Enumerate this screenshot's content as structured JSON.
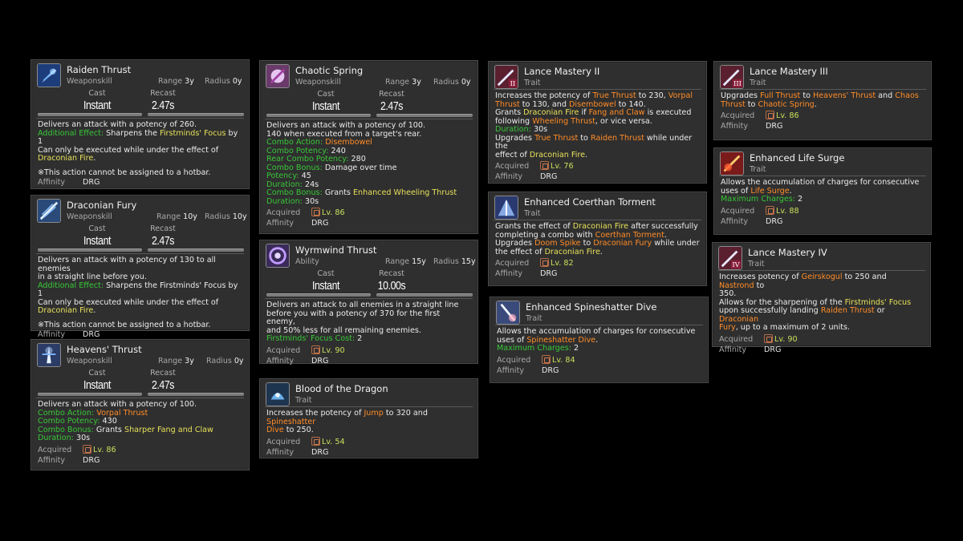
{
  "labels": {
    "cast": "Cast",
    "recast": "Recast",
    "range": "Range",
    "radius": "Radius",
    "acquired": "Acquired",
    "affinity": "Affinity"
  },
  "cards": {
    "raiden": {
      "title": "Raiden Thrust",
      "kind": "Weaponskill",
      "range": "3y",
      "radius": "0y",
      "cast": "Instant",
      "recast": "2.47s",
      "d1": "Delivers an attack with a potency of 260.",
      "d2a": "Additional Effect:",
      "d2b": " Sharpens the ",
      "d2c": "Firstminds' Focus",
      "d2d": " by 1",
      "d3": "Can only be executed while under the effect of",
      "d4": "Draconian Fire",
      "d4b": ".",
      "note": "※This action cannot be assigned to a hotbar.",
      "affinity": "DRG"
    },
    "fury": {
      "title": "Draconian Fury",
      "kind": "Weaponskill",
      "range": "10y",
      "radius": "10y",
      "cast": "Instant",
      "recast": "2.47s",
      "d1": "Delivers an attack with a potency of 130 to all enemies",
      "d1b": "in a straight line before you.",
      "d2a": "Additional Effect:",
      "d2b": " Sharpens the Firstminds' Focus by 1",
      "d3": "Can only be executed while under the effect of",
      "d4": "Draconian Fire",
      "d4b": ".",
      "note": "※This action cannot be assigned to a hotbar.",
      "affinity": "DRG"
    },
    "heavens": {
      "title": "Heavens' Thrust",
      "kind": "Weaponskill",
      "range": "3y",
      "radius": "0y",
      "cast": "Instant",
      "recast": "2.47s",
      "d1": "Delivers an attack with a potency of 100.",
      "d2a": "Combo Action:",
      "d2b": "Vorpal Thrust",
      "d3a": "Combo Potency:",
      "d3b": "430",
      "d4a": "Combo Bonus:",
      "d4b": "Grants",
      "d4c": "Sharper Fang and Claw",
      "d5a": "Duration:",
      "d5b": "30s",
      "level": "Lv. 86",
      "affinity": "DRG"
    },
    "chaotic": {
      "title": "Chaotic Spring",
      "kind": "Weaponskill",
      "range": "3y",
      "radius": "0y",
      "cast": "Instant",
      "recast": "2.47s",
      "d1": "Delivers an attack with a potency of 100.",
      "d1b": "140 when executed from a target's rear.",
      "d2a": "Combo Action:",
      "d2b": "Disembowel",
      "d3a": "Combo Potency:",
      "d3b": "240",
      "d4a": "Rear Combo Potency:",
      "d4b": "280",
      "d5a": "Combo Bonus:",
      "d5b": "Damage over time",
      "d6a": "Potency:",
      "d6b": "45",
      "d7a": "Duration:",
      "d7b": "24s",
      "d8a": "Combo Bonus:",
      "d8b": "Grants",
      "d8c": "Enhanced Wheeling Thrust",
      "d9a": "Duration:",
      "d9b": "30s",
      "level": "Lv. 86",
      "affinity": "DRG"
    },
    "wyrmwind": {
      "title": "Wyrmwind Thrust",
      "kind": "Ability",
      "range": "15y",
      "radius": "15y",
      "cast": "Instant",
      "recast": "10.00s",
      "d1": "Delivers an attack to all enemies in a straight line",
      "d1b": "before you with a potency of 370 for the first enemy,",
      "d1c": "and 50% less for all remaining enemies.",
      "d2a": "Firstminds' Focus Cost:",
      "d2b": "2",
      "level": "Lv. 90",
      "affinity": "DRG"
    },
    "blood": {
      "title": "Blood of the Dragon",
      "kind": "Trait",
      "d1": "Increases the potency of",
      "d1b": "Jump",
      "d1c": "to 320 and",
      "d1d": "Spineshatter",
      "d2": "Dive",
      "d2b": "to 250.",
      "level": "Lv. 54",
      "affinity": "DRG"
    },
    "lm2": {
      "title": "Lance Mastery II",
      "kind": "Trait",
      "d1": "Increases the potency of",
      "d1b": "True Thrust",
      "d1c": "to 230,",
      "d1d": "Vorpal",
      "d2": "Thrust",
      "d2b": "to 130, and",
      "d2c": "Disembowel",
      "d2d": "to 140.",
      "d3": "Grants",
      "d3b": "Draconian Fire",
      "d3c": "if",
      "d3d": "Fang and Claw",
      "d3e": "is executed",
      "d4": "following",
      "d4b": "Wheeling Thrust",
      "d4c": ", or vice versa.",
      "d5a": "Duration:",
      "d5b": "30s",
      "d6": "Upgrades",
      "d6b": "True Thrust",
      "d6c": "to",
      "d6d": "Raiden Thrust",
      "d6e": "while under the",
      "d7": "effect of",
      "d7b": "Draconian Fire",
      "d7c": ".",
      "level": "Lv. 76",
      "affinity": "DRG"
    },
    "coerthan": {
      "title": "Enhanced Coerthan Torment",
      "kind": "Trait",
      "d1": "Grants the effect of",
      "d1b": "Draconian Fire",
      "d1c": "after successfully",
      "d2": "completing a combo with",
      "d2b": "Coerthan Torment",
      "d2c": ".",
      "d3": "Upgrades",
      "d3b": "Doom Spike",
      "d3c": "to",
      "d3d": "Draconian Fury",
      "d3e": "while under",
      "d4": "the effect of",
      "d4b": "Draconian Fire",
      "d4c": ".",
      "level": "Lv. 82",
      "affinity": "DRG"
    },
    "spineshatter": {
      "title": "Enhanced Spineshatter Dive",
      "kind": "Trait",
      "d1": "Allows the accumulation of charges for consecutive",
      "d2": "uses of",
      "d2b": "Spineshatter Dive",
      "d2c": ".",
      "d3a": "Maximum Charges:",
      "d3b": "2",
      "level": "Lv. 84",
      "affinity": "DRG"
    },
    "lm3": {
      "title": "Lance Mastery III",
      "kind": "Trait",
      "d1": "Upgrades",
      "d1b": "Full Thrust",
      "d1c": "to",
      "d1d": "Heavens' Thrust",
      "d1e": "and",
      "d1f": "Chaos",
      "d2": "Thrust",
      "d2b": "to",
      "d2c": "Chaotic Spring",
      "d2d": ".",
      "level": "Lv. 86",
      "affinity": "DRG"
    },
    "surge": {
      "title": "Enhanced Life Surge",
      "kind": "Trait",
      "d1": "Allows the accumulation of charges for consecutive",
      "d2": "uses of",
      "d2b": "Life Surge",
      "d2c": ".",
      "d3a": "Maximum Charges:",
      "d3b": "2",
      "level": "Lv. 88",
      "affinity": "DRG"
    },
    "lm4": {
      "title": "Lance Mastery IV",
      "kind": "Trait",
      "d1": "Increases potency of",
      "d1b": "Geirskogul",
      "d1c": "to 250 and",
      "d1d": "Nastrond",
      "d1e": "to",
      "d2": "350.",
      "d3": "Allows for the sharpening of the",
      "d3b": "Firstminds' Focus",
      "d4": "upon successfully landing",
      "d4b": "Raiden Thrust",
      "d4c": "or",
      "d4d": "Draconian",
      "d5": "Fury",
      "d5b": ", up to a maximum of 2 units.",
      "level": "Lv. 90",
      "affinity": "DRG"
    }
  },
  "colors": {
    "bg": "#000000",
    "card": "#2f2f2f",
    "green": "#37c737",
    "orange": "#ff8c28",
    "yellow": "#e6e05a",
    "level": "#c7e05a"
  }
}
